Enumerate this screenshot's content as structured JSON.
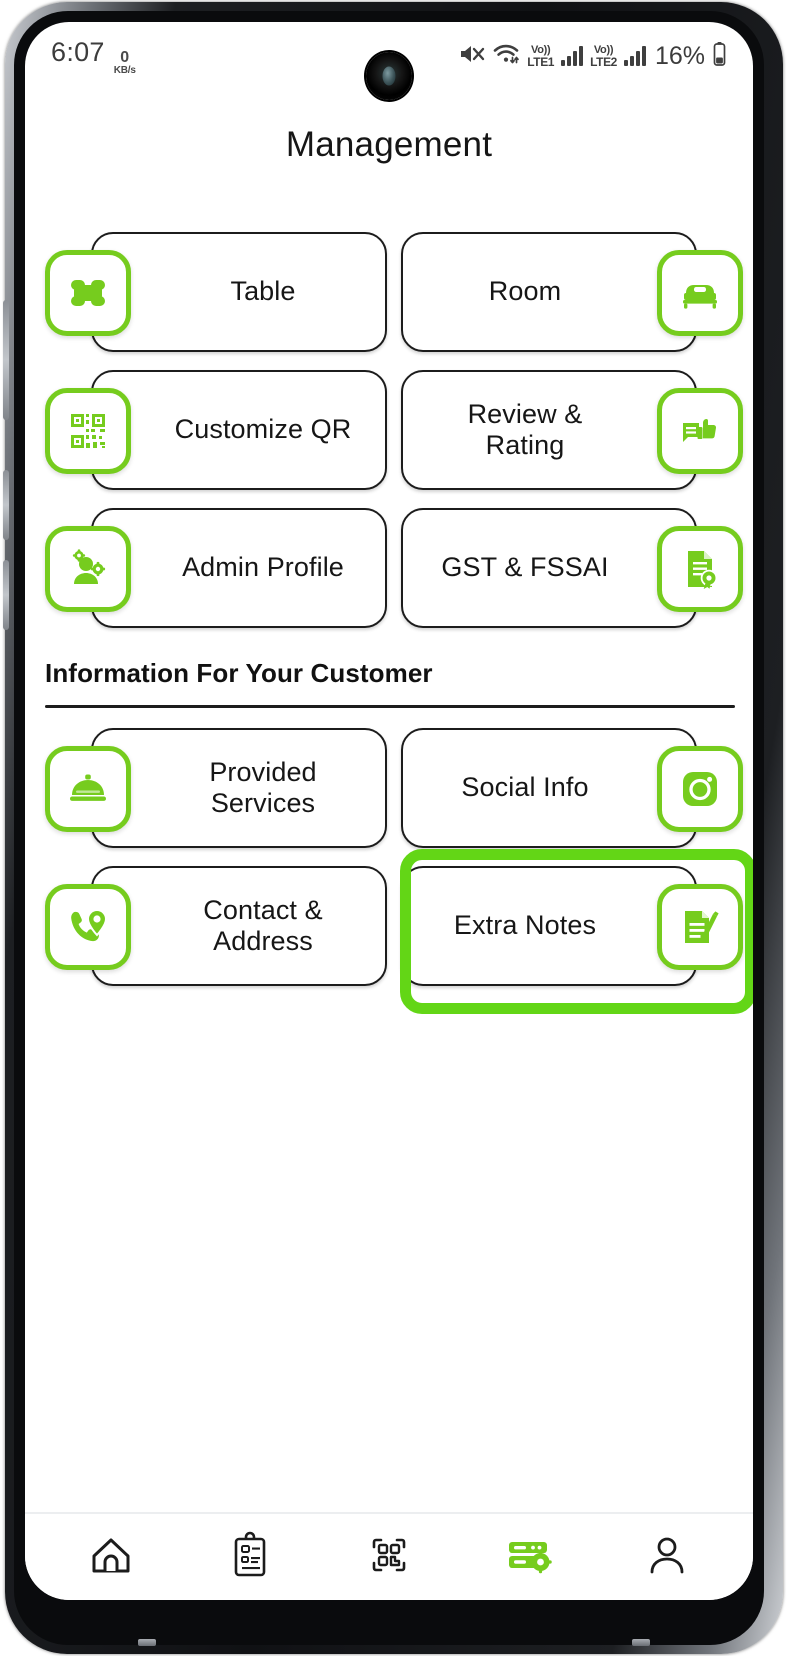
{
  "status_bar": {
    "time": "6:07",
    "network_speed_value": "0",
    "network_speed_unit": "KB/s",
    "mute_icon": "mute-icon",
    "wifi_icon": "wifi-icon",
    "sim1_volte_top": "Vo))",
    "sim1_volte_label": "LTE1",
    "sim2_volte_top": "Vo))",
    "sim2_volte_label": "LTE2",
    "battery_percent": "16%",
    "battery_icon": "battery-icon"
  },
  "header": {
    "title": "Management"
  },
  "management_cards": [
    {
      "label": "Table",
      "icon": "table-icon",
      "side": "left"
    },
    {
      "label": "Room",
      "icon": "bed-icon",
      "side": "right"
    },
    {
      "label": "Customize QR",
      "icon": "qr-code-icon",
      "side": "left"
    },
    {
      "label": "Review &\nRating",
      "icon": "review-thumb-icon",
      "side": "right"
    },
    {
      "label": "Admin Profile",
      "icon": "admin-user-icon",
      "side": "left"
    },
    {
      "label": "GST & FSSAI",
      "icon": "certificate-icon",
      "side": "right"
    }
  ],
  "section": {
    "title": "Information For Your Customer",
    "cards": [
      {
        "label": "Provided\nServices",
        "icon": "service-bell-icon",
        "side": "left"
      },
      {
        "label": "Social Info",
        "icon": "instagram-icon",
        "side": "right"
      },
      {
        "label": "Contact &\nAddress",
        "icon": "phone-location-icon",
        "side": "left"
      },
      {
        "label": "Extra Notes",
        "icon": "notes-pencil-icon",
        "side": "right",
        "highlighted": true
      }
    ]
  },
  "bottom_nav": [
    {
      "name": "home",
      "icon": "home-icon",
      "active": false
    },
    {
      "name": "orders",
      "icon": "clipboard-icon",
      "active": false
    },
    {
      "name": "scan",
      "icon": "qr-scan-icon",
      "active": false
    },
    {
      "name": "management",
      "icon": "server-gear-icon",
      "active": true
    },
    {
      "name": "profile",
      "icon": "person-icon",
      "active": false
    }
  ],
  "colors": {
    "accent_green": "#76cc1e",
    "highlight_green": "#63d616",
    "card_border": "#1c1c1c",
    "text": "#161616"
  }
}
